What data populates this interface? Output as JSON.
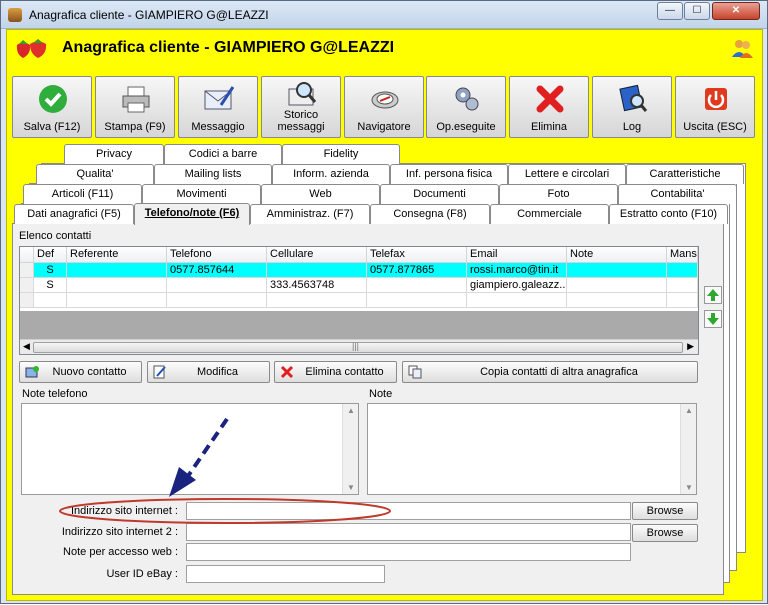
{
  "window": {
    "title": "Anagrafica cliente - GIAMPIERO G@LEAZZI"
  },
  "header": {
    "title": "Anagrafica cliente - GIAMPIERO G@LEAZZI"
  },
  "toolbar": {
    "salva": "Salva (F12)",
    "stampa": "Stampa (F9)",
    "messaggio": "Messaggio",
    "storico_1": "Storico",
    "storico_2": "messaggi",
    "navigatore": "Navigatore",
    "opeseguite": "Op.eseguite",
    "elimina": "Elimina",
    "log": "Log",
    "uscita": "Uscita (ESC)"
  },
  "tabs": {
    "row1": [
      "Privacy",
      "Codici a barre",
      "Fidelity"
    ],
    "row2": [
      "Qualita'",
      "Mailing lists",
      "Inform. azienda",
      "Inf. persona fisica",
      "Lettere e circolari",
      "Caratteristiche"
    ],
    "row3": [
      "Articoli (F11)",
      "Movimenti",
      "Web",
      "Documenti",
      "Foto",
      "Contabilita'"
    ],
    "row4": [
      "Dati anagrafici (F5)",
      "Telefono/note (F6)",
      "Amministraz. (F7)",
      "Consegna (F8)",
      "Commerciale",
      "Estratto conto (F10)"
    ]
  },
  "contacts": {
    "section_label": "Elenco contatti",
    "columns": [
      "Def",
      "Referente",
      "Telefono",
      "Cellulare",
      "Telefax",
      "Email",
      "Note",
      "Mans"
    ],
    "rows": [
      [
        "S",
        "",
        "0577.857644",
        "",
        "0577.877865",
        "rossi.marco@tin.it",
        "",
        ""
      ],
      [
        "S",
        "",
        "",
        "333.4563748",
        "",
        "giampiero.galeazz...",
        "",
        ""
      ]
    ]
  },
  "buttons": {
    "nuovo": "Nuovo contatto",
    "modifica": "Modifica",
    "elimina_contatto": "Elimina contatto",
    "copia": "Copia contatti di altra anagrafica",
    "browse1": "Browse",
    "browse2": "Browse"
  },
  "notes": {
    "telefono_label": "Note telefono",
    "note_label": "Note"
  },
  "form": {
    "sito1_label": "Indirizzo sito internet :",
    "sito2_label": "Indirizzo sito internet 2 :",
    "noteweb_label": "Note per accesso web :",
    "ebay_label": "User ID eBay :"
  },
  "colors": {
    "accent": "#ffff00",
    "selected_row": "#00ffff",
    "annotation_ellipse": "#c0392b",
    "annotation_arrow": "#1a237e"
  }
}
